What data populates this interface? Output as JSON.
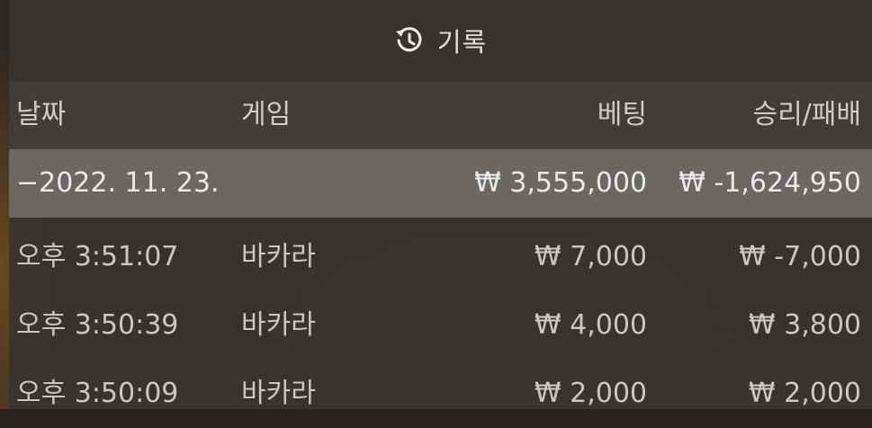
{
  "header": {
    "title": "기록",
    "icon": "history-icon"
  },
  "columns": {
    "date": "날짜",
    "game": "게임",
    "bet": "베팅",
    "result": "승리/패배"
  },
  "date_group": {
    "label": "−2022. 11. 23.",
    "total_bet": "₩ 3,555,000",
    "total_result": "₩ -1,624,950"
  },
  "entries": [
    {
      "time": "오후 3:51:07",
      "game": "바카라",
      "bet": "₩ 7,000",
      "result": "₩ -7,000"
    },
    {
      "time": "오후 3:50:39",
      "game": "바카라",
      "bet": "₩ 4,000",
      "result": "₩ 3,800"
    },
    {
      "time": "오후 3:50:09",
      "game": "바카라",
      "bet": "₩ 2,000",
      "result": "₩ 2,000"
    }
  ],
  "colors": {
    "panel": "#373432",
    "header_row": "#403c39",
    "date_row": "#6a6765",
    "text": "#d8d6d4"
  }
}
